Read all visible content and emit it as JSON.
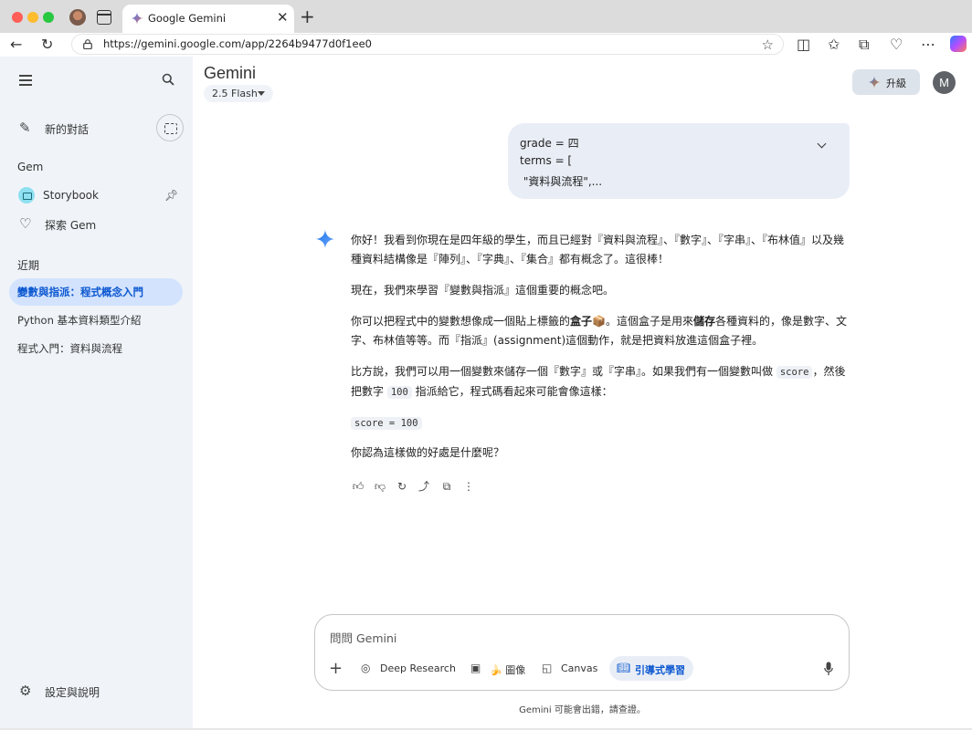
{
  "browser": {
    "tab_title": "Google Gemini",
    "url": "https://gemini.google.com/app/2264b9477d0f1ee0"
  },
  "sidebar": {
    "new_chat": "新的對話",
    "gem_section": "Gem",
    "gems": [
      {
        "label": "Storybook",
        "icon": "storybook-icon"
      },
      {
        "label": "探索 Gem",
        "icon": "gem-heart-icon"
      }
    ],
    "recent_section": "近期",
    "recent": [
      {
        "label": "變數與指派：程式概念入門",
        "active": true
      },
      {
        "label": "Python 基本資料類型介紹",
        "active": false
      },
      {
        "label": "程式入門：資料與流程",
        "active": false
      }
    ],
    "settings": "設定與說明"
  },
  "header": {
    "title": "Gemini",
    "model": "2.5 Flash",
    "upgrade": "升級",
    "avatar_letter": "M"
  },
  "chat": {
    "user_message_lines": [
      "grade = 四",
      "terms = [",
      " \"資料與流程\",..."
    ],
    "response": {
      "p1": "你好！我看到你現在是四年級的學生，而且已經對『資料與流程』、『數字』、『字串』、『布林值』以及幾種資料結構像是『陣列』、『字典』、『集合』都有概念了。這很棒！",
      "p2": "現在，我們來學習『變數與指派』這個重要的概念吧。",
      "p3_a": "你可以把程式中的變數想像成一個貼上標籤的",
      "p3_box": "盒子",
      "p3_emoji": "📦",
      "p3_b": "。這個盒子是用來",
      "p3_store": "儲存",
      "p3_c": "各種資料的，像是數字、文字、布林值等等。而『指派』(assignment)這個動作，就是把資料放進這個盒子裡。",
      "p4_a": "比方說，我們可以用一個變數來儲存一個『數字』或『字串』。如果我們有一個變數叫做",
      "p4_code1": "score",
      "p4_b": "，然後把數字",
      "p4_code2": "100",
      "p4_c": "指派給它，程式碼看起來可能會像這樣：",
      "code_line": "score = 100",
      "p5": "你認為這樣做的好處是什麼呢？"
    }
  },
  "composer": {
    "placeholder": "問問 Gemini",
    "tools": [
      {
        "label": "Deep Research",
        "icon": "deep-research-icon",
        "active": false
      },
      {
        "label": "🍌 圖像",
        "icon": "image-icon",
        "active": false
      },
      {
        "label": "Canvas",
        "icon": "canvas-icon",
        "active": false
      },
      {
        "label": "引導式學習",
        "icon": "guided-learning-icon",
        "active": true
      }
    ],
    "disclaimer": "Gemini 可能會出錯，請查證。"
  },
  "colors": {
    "sidebar_bg": "#f0f4f9",
    "active_item_bg": "#d3e3fd",
    "accent_blue": "#0b57d0",
    "user_bubble_bg": "#e9eef6"
  }
}
